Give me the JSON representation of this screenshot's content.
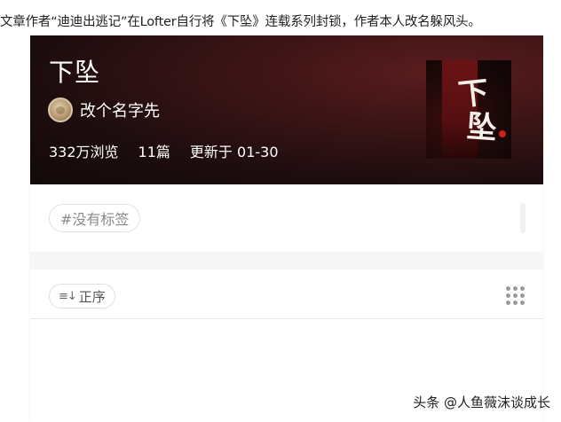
{
  "article": {
    "text": "文章作者“迪迪出逃记”在Lofter自行将《下坠》连载系列封锁，作者本人改名躲风头。"
  },
  "collection": {
    "title": "下坠",
    "author": "改个名字先",
    "views": "332万浏览",
    "count": "11篇",
    "updated": "更新于 01-30",
    "cover_chars": [
      "下",
      "坠"
    ]
  },
  "tags": {
    "chip": "#没有标签"
  },
  "toolbar": {
    "sort_icon": "≡↓",
    "sort_label": "正序",
    "grid_icon": "grid-dots-icon"
  },
  "watermark": "头条 @人鱼薇沫谈成长",
  "colors": {
    "hero_dark": "#1d0d0e",
    "hero_red": "#5a1c1e",
    "cover_dot": "#c8201e"
  }
}
